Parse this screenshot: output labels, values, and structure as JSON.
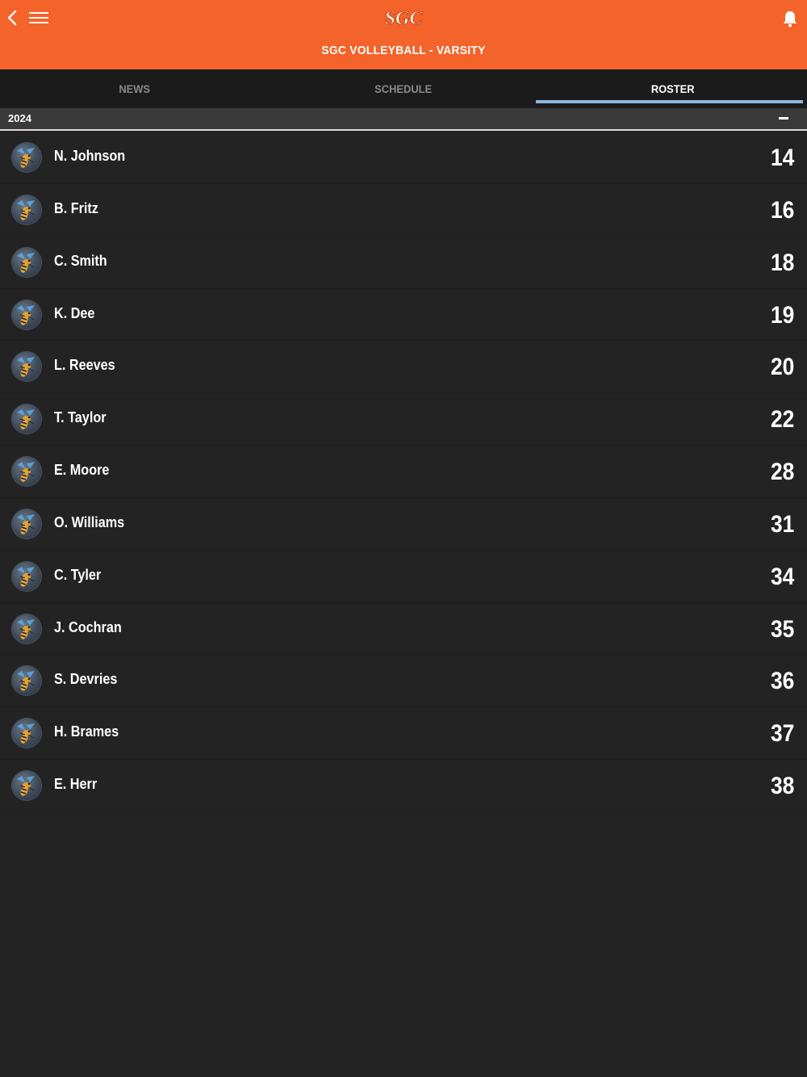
{
  "header": {
    "logo_text": "SGC",
    "title": "SGC VOLLEYBALL - VARSITY"
  },
  "tabs": [
    {
      "label": "NEWS",
      "active": false
    },
    {
      "label": "SCHEDULE",
      "active": false
    },
    {
      "label": "ROSTER",
      "active": true
    }
  ],
  "roster": {
    "year": "2024",
    "collapse_icon": "minus-icon",
    "players": [
      {
        "name": "N. Johnson",
        "number": "14"
      },
      {
        "name": "B. Fritz",
        "number": "16"
      },
      {
        "name": "C. Smith",
        "number": "18"
      },
      {
        "name": "K. Dee",
        "number": "19"
      },
      {
        "name": "L. Reeves",
        "number": "20"
      },
      {
        "name": "T. Taylor",
        "number": "22"
      },
      {
        "name": "E. Moore",
        "number": "28"
      },
      {
        "name": "O. Williams",
        "number": "31"
      },
      {
        "name": "C. Tyler",
        "number": "34"
      },
      {
        "name": "J. Cochran",
        "number": "35"
      },
      {
        "name": "S. Devries",
        "number": "36"
      },
      {
        "name": "H. Brames",
        "number": "37"
      },
      {
        "name": "E. Herr",
        "number": "38"
      }
    ]
  },
  "colors": {
    "header_bg": "#f4632a",
    "tab_indicator": "#8fb7e0",
    "body_bg": "#232323"
  }
}
